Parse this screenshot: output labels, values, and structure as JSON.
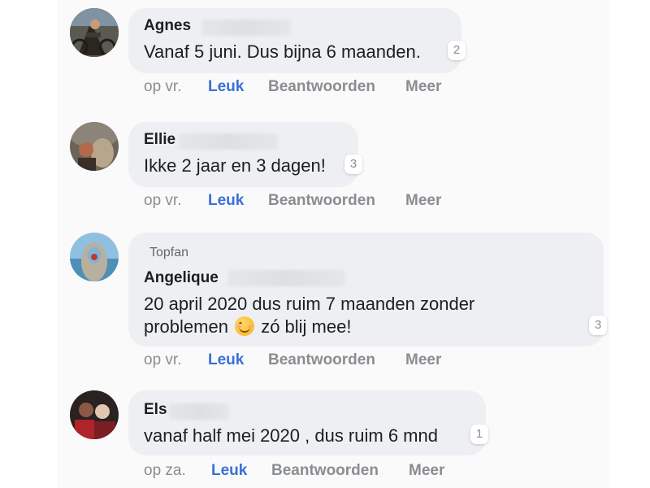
{
  "comments": [
    {
      "name": "Agnes",
      "text": "Vanaf 5 juni. Dus bijna 6 maanden.",
      "reactions": "2",
      "time": "op vr.",
      "like": "Leuk",
      "reply": "Beantwoorden",
      "more": "Meer"
    },
    {
      "name": "Ellie",
      "text": "Ikke 2 jaar en 3 dagen!",
      "reactions": "3",
      "time": "op vr.",
      "like": "Leuk",
      "reply": "Beantwoorden",
      "more": "Meer"
    },
    {
      "badge": "Topfan",
      "name": "Angelique",
      "text_line1": "20 april 2020 dus ruim 7 maanden zonder",
      "text_line2a": "problemen",
      "text_line2b": "zó blij mee!",
      "reactions": "3",
      "time": "op vr.",
      "like": "Leuk",
      "reply": "Beantwoorden",
      "more": "Meer"
    },
    {
      "name": "Els",
      "text": "vanaf half mei 2020 , dus ruim 6 mnd",
      "reactions": "1",
      "time": "op za.",
      "like": "Leuk",
      "reply": "Beantwoorden",
      "more": "Meer"
    }
  ],
  "colors": {
    "bubble": "#eeeff2",
    "like": "#3b6fd8",
    "muted": "#8a8d91",
    "text": "#1c1e21"
  },
  "icons": {
    "emoji": "smiling-face-emoji"
  }
}
